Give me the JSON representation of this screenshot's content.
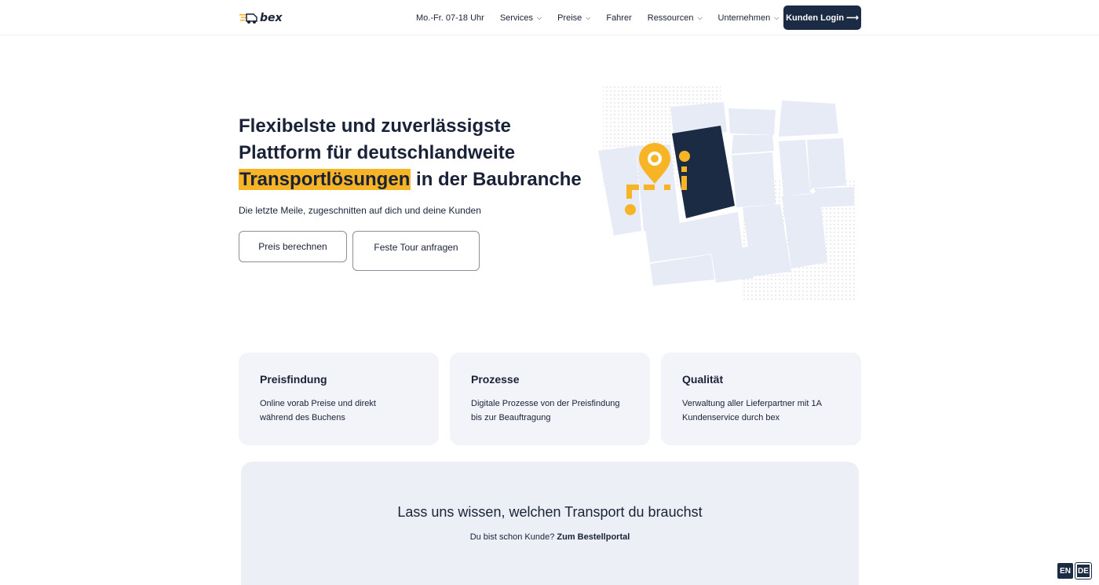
{
  "header": {
    "logo_text": "bex",
    "hours": "Mo.-Fr. 07-18 Uhr",
    "nav": [
      {
        "label": "Services",
        "dropdown": true
      },
      {
        "label": "Preise",
        "dropdown": true
      },
      {
        "label": "Fahrer",
        "dropdown": false
      },
      {
        "label": "Ressourcen",
        "dropdown": true
      },
      {
        "label": "Unternehmen",
        "dropdown": true
      }
    ],
    "login_label": "Kunden Login ⟶"
  },
  "hero": {
    "title_line1": "Flexibelste und zuverlässigste",
    "title_line2": "Plattform für deutschlandweite",
    "title_highlight": "Transportlösungen",
    "title_rest": " in der Baubranche",
    "subtitle": "Die letzte Meile, zugeschnitten auf dich und deine Kunden",
    "btn_price": "Preis berechnen",
    "btn_tour": "Feste Tour anfragen"
  },
  "colors": {
    "accent": "#f7b526",
    "navy": "#1b2b44",
    "card_bg": "#f2f4f9",
    "map_block": "#e6ebf6"
  },
  "features": [
    {
      "title": "Preisfindung",
      "text": "Online vorab Preise und direkt während des Buchens"
    },
    {
      "title": "Prozesse",
      "text": "Digitale Prozesse von der Preisfindung bis zur Beauftragung"
    },
    {
      "title": "Qualität",
      "text": "Verwaltung aller Lieferpartner mit 1A Kundenservice durch bex"
    }
  ],
  "cta": {
    "title": "Lass uns wissen, welchen Transport du brauchst",
    "question": "Du bist schon Kunde?",
    "link": "Zum Bestellportal"
  },
  "lang": {
    "en": "EN",
    "de": "DE"
  }
}
